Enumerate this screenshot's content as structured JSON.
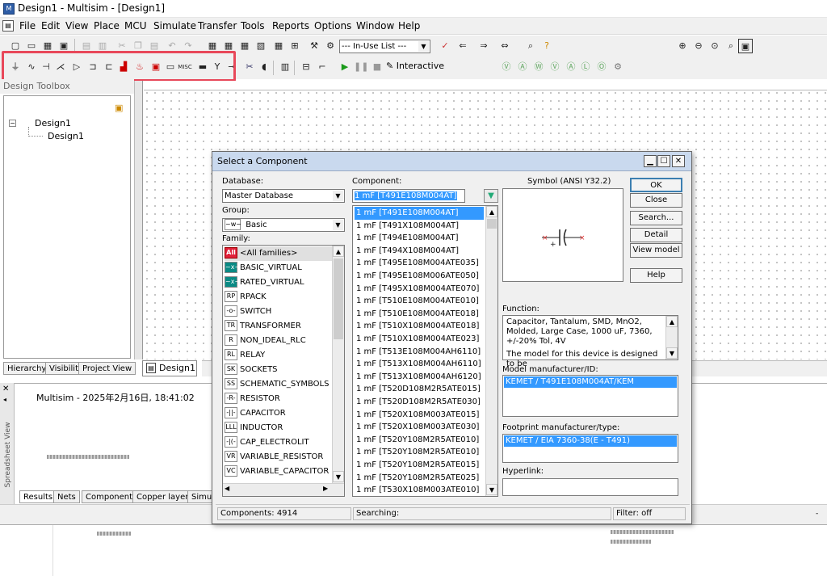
{
  "window": {
    "title": "Design1 - Multisim - [Design1]",
    "app_icon": "multisim-icon"
  },
  "menu": [
    "File",
    "Edit",
    "View",
    "Place",
    "MCU",
    "Simulate",
    "Transfer",
    "Tools",
    "Reports",
    "Options",
    "Window",
    "Help"
  ],
  "toolbar": {
    "in_use_list": "--- In-Use List ---",
    "interactive_label": "Interactive",
    "highlight_color": "#e8485a"
  },
  "left_panel": {
    "title": "Design Toolbox",
    "tree_root": "Design1",
    "tree_child": "Design1",
    "tabs": [
      "Hierarchy",
      "Visibility",
      "Project View"
    ]
  },
  "workspace": {
    "sheet_tab": "Design1"
  },
  "spreadsheet": {
    "side_label": "Spreadsheet View",
    "log_text": "Multisim  -  2025年2月16日, 18:41:02",
    "tabs": [
      "Results",
      "Nets",
      "Components",
      "Copper layers",
      "Simula"
    ]
  },
  "dialog": {
    "title": "Select a Component",
    "database_label": "Database:",
    "database_value": "Master Database",
    "group_label": "Group:",
    "group_value": "Basic",
    "family_label": "Family:",
    "families": [
      "<All families>",
      "BASIC_VIRTUAL",
      "RATED_VIRTUAL",
      "RPACK",
      "SWITCH",
      "TRANSFORMER",
      "NON_IDEAL_RLC",
      "RELAY",
      "SOCKETS",
      "SCHEMATIC_SYMBOLS",
      "RESISTOR",
      "CAPACITOR",
      "INDUCTOR",
      "CAP_ELECTROLIT",
      "VARIABLE_RESISTOR",
      "VARIABLE_CAPACITOR"
    ],
    "family_icons": [
      "All",
      "~x~",
      "~x~",
      "RP",
      "-o-",
      "TR",
      "R",
      "RL",
      "SK",
      "SS",
      "-R-",
      "-||-",
      "LLL",
      "-|(-",
      "VR",
      "VC"
    ],
    "component_label": "Component:",
    "component_value": "1 mF  [T491E108M004AT]",
    "components": [
      "1 mF  [T491E108M004AT]",
      "1 mF  [T491X108M004AT]",
      "1 mF  [T494E108M004AT]",
      "1 mF  [T494X108M004AT]",
      "1 mF  [T495E108M004ATE035]",
      "1 mF  [T495E108M006ATE050]",
      "1 mF  [T495X108M004ATE070]",
      "1 mF  [T510E108M004ATE010]",
      "1 mF  [T510E108M004ATE018]",
      "1 mF  [T510X108M004ATE018]",
      "1 mF  [T510X108M004ATE023]",
      "1 mF  [T513E108M004AH6110]",
      "1 mF  [T513X108M004AH6110]",
      "1 mF  [T513X108M004AH6120]",
      "1 mF  [T520D108M2R5ATE015]",
      "1 mF  [T520D108M2R5ATE030]",
      "1 mF  [T520X108M003ATE015]",
      "1 mF  [T520X108M003ATE030]",
      "1 mF  [T520Y108M2R5ATE010]",
      "1 mF  [T520Y108M2R5ATE010]",
      "1 mF  [T520Y108M2R5ATE015]",
      "1 mF  [T520Y108M2R5ATE025]",
      "1 mF  [T530X108M003ATE010]"
    ],
    "symbol_label": "Symbol (ANSI Y32.2)",
    "function_label": "Function:",
    "function_text_1": "Capacitor, Tantalum, SMD, MnO2, Molded, Large Case, 1000 uF, 7360, +/-20% Tol, 4V",
    "function_text_2": "The model for this device is designed to be",
    "model_label": "Model manufacturer/ID:",
    "model_value": "KEMET / T491E108M004AT/KEM",
    "footprint_label": "Footprint manufacturer/type:",
    "footprint_value": "KEMET / EIA 7360-38(E - T491)",
    "hyperlink_label": "Hyperlink:",
    "buttons": [
      "OK",
      "Close",
      "Search...",
      "Detail report",
      "View model",
      "Help"
    ],
    "status_components": "Components: 4914",
    "status_searching": "Searching:",
    "status_filter": "Filter: off"
  }
}
